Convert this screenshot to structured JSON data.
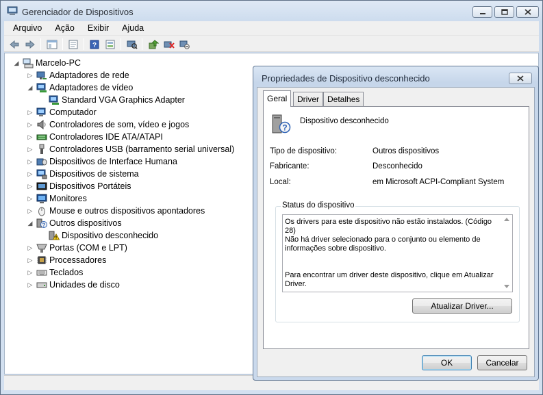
{
  "window": {
    "title": "Gerenciador de Dispositivos",
    "menu": [
      "Arquivo",
      "Ação",
      "Exibir",
      "Ajuda"
    ]
  },
  "toolbar": {
    "icons": [
      "back-arrow-icon",
      "forward-arrow-icon",
      "show-hide-console-tree-icon",
      "properties-icon",
      "help-icon",
      "view-icon",
      "scan-hardware-icon",
      "update-driver-icon",
      "uninstall-device-icon",
      "disable-device-icon"
    ]
  },
  "tree": {
    "root": "Marcelo-PC",
    "items": [
      {
        "label": "Adaptadores de rede",
        "level": 1,
        "state": "collapsed",
        "icon": "network-adapter-icon"
      },
      {
        "label": "Adaptadores de vídeo",
        "level": 1,
        "state": "expanded",
        "icon": "display-adapter-icon"
      },
      {
        "label": "Standard VGA Graphics Adapter",
        "level": 2,
        "state": "leaf",
        "icon": "display-adapter-icon"
      },
      {
        "label": "Computador",
        "level": 1,
        "state": "collapsed",
        "icon": "computer-icon"
      },
      {
        "label": "Controladores de som, vídeo e jogos",
        "level": 1,
        "state": "collapsed",
        "icon": "speaker-icon"
      },
      {
        "label": "Controladores IDE ATA/ATAPI",
        "level": 1,
        "state": "collapsed",
        "icon": "ide-controller-icon"
      },
      {
        "label": "Controladores USB (barramento serial universal)",
        "level": 1,
        "state": "collapsed",
        "icon": "usb-icon"
      },
      {
        "label": "Dispositivos de Interface Humana",
        "level": 1,
        "state": "collapsed",
        "icon": "hid-icon"
      },
      {
        "label": "Dispositivos de sistema",
        "level": 1,
        "state": "collapsed",
        "icon": "system-device-icon"
      },
      {
        "label": "Dispositivos Portáteis",
        "level": 1,
        "state": "collapsed",
        "icon": "portable-device-icon"
      },
      {
        "label": "Monitores",
        "level": 1,
        "state": "collapsed",
        "icon": "monitor-icon"
      },
      {
        "label": "Mouse e outros dispositivos apontadores",
        "level": 1,
        "state": "collapsed",
        "icon": "mouse-icon"
      },
      {
        "label": "Outros dispositivos",
        "level": 1,
        "state": "expanded",
        "icon": "unknown-device-icon"
      },
      {
        "label": "Dispositivo desconhecido",
        "level": 2,
        "state": "leaf",
        "icon": "warning-device-icon"
      },
      {
        "label": "Portas (COM e LPT)",
        "level": 1,
        "state": "collapsed",
        "icon": "port-icon"
      },
      {
        "label": "Processadores",
        "level": 1,
        "state": "collapsed",
        "icon": "processor-icon"
      },
      {
        "label": "Teclados",
        "level": 1,
        "state": "collapsed",
        "icon": "keyboard-icon"
      },
      {
        "label": "Unidades de disco",
        "level": 1,
        "state": "collapsed",
        "icon": "disk-drive-icon"
      }
    ]
  },
  "dialog": {
    "title": "Propriedades de Dispositivo desconhecido",
    "tabs": [
      "Geral",
      "Driver",
      "Detalhes"
    ],
    "active_tab": "Geral",
    "device_name": "Dispositivo desconhecido",
    "props": [
      {
        "label": "Tipo de dispositivo:",
        "value": "Outros dispositivos"
      },
      {
        "label": "Fabricante:",
        "value": "Desconhecido"
      },
      {
        "label": "Local:",
        "value": "em Microsoft ACPI-Compliant System"
      }
    ],
    "status_title": "Status do dispositivo",
    "status_paragraphs": [
      "Os drivers para este dispositivo não estão instalados. (Código 28)",
      "Não há driver selecionado para o conjunto ou elemento de informações sobre dispositivo.",
      "Para encontrar um driver deste dispositivo, clique em Atualizar Driver."
    ],
    "update_button": "Atualizar Driver...",
    "ok_button": "OK",
    "cancel_button": "Cancelar"
  }
}
